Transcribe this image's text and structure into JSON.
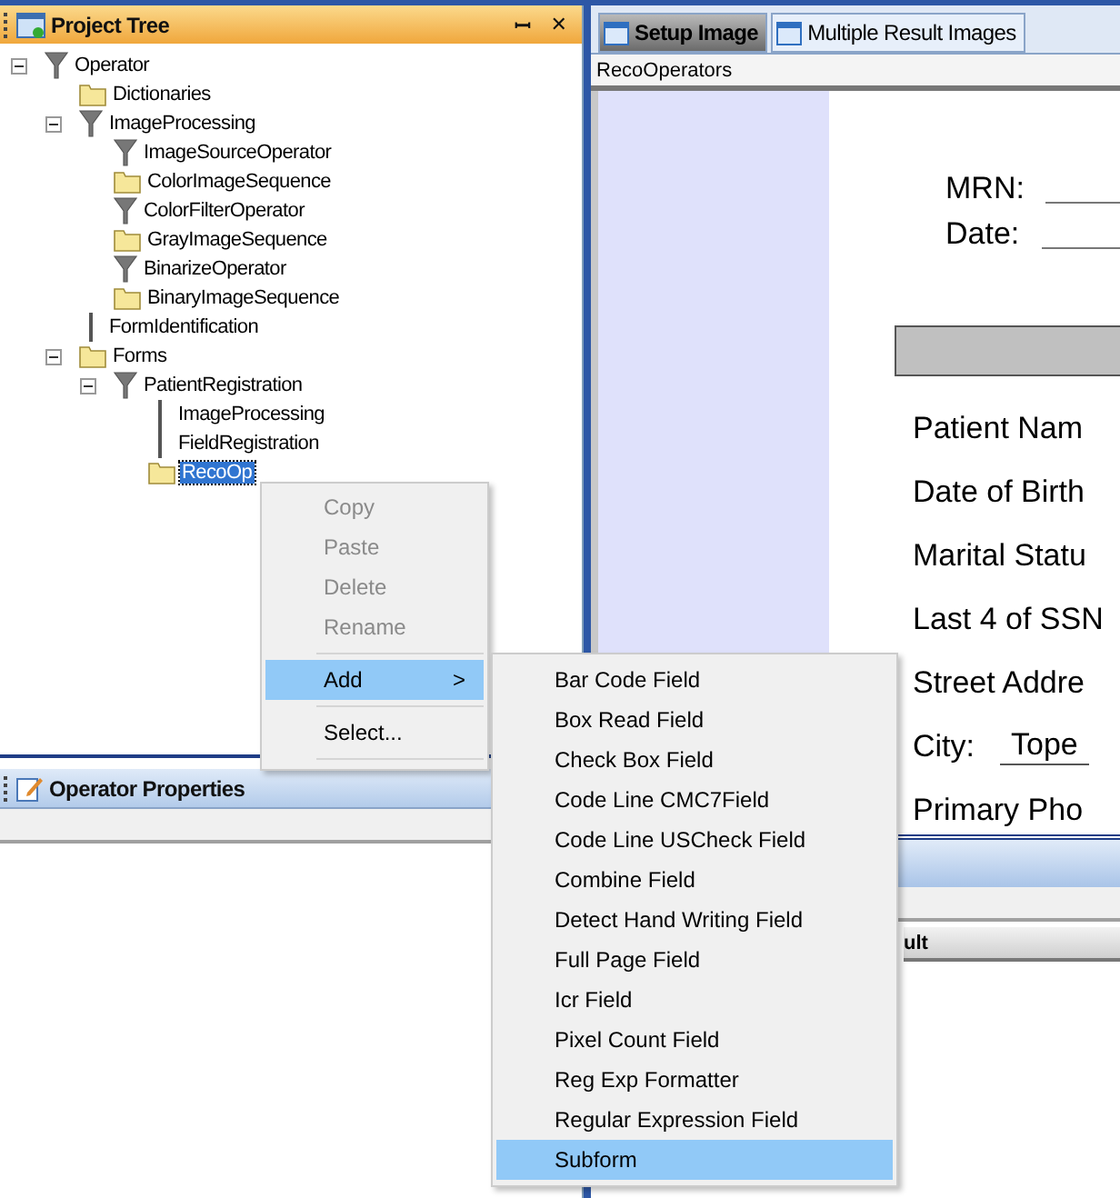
{
  "project_tree": {
    "title": "Project Tree",
    "pin": "ꟷ",
    "close": "✕",
    "nodes": [
      {
        "label": "Operator",
        "kind": "operator",
        "expanded": true,
        "selected": false,
        "children": [
          {
            "label": "Dictionaries",
            "kind": "folder",
            "selected": false
          },
          {
            "label": "ImageProcessing",
            "kind": "operator",
            "expanded": true,
            "selected": false,
            "children": [
              {
                "label": "ImageSourceOperator",
                "kind": "operator",
                "selected": false
              },
              {
                "label": "ColorImageSequence",
                "kind": "folder",
                "selected": false
              },
              {
                "label": "ColorFilterOperator",
                "kind": "operator",
                "selected": false
              },
              {
                "label": "GrayImageSequence",
                "kind": "folder",
                "selected": false
              },
              {
                "label": "BinarizeOperator",
                "kind": "operator",
                "selected": false
              },
              {
                "label": "BinaryImageSequence",
                "kind": "folder",
                "selected": false
              }
            ]
          },
          {
            "label": "FormIdentification",
            "kind": "item",
            "selected": false
          },
          {
            "label": "Forms",
            "kind": "folder",
            "expanded": true,
            "selected": false,
            "children": [
              {
                "label": "PatientRegistration",
                "kind": "operator",
                "expanded": true,
                "selected": false,
                "children": [
                  {
                    "label": "ImageProcessing",
                    "kind": "item",
                    "selected": false
                  },
                  {
                    "label": "FieldRegistration",
                    "kind": "item",
                    "selected": false
                  },
                  {
                    "label": "RecoOp",
                    "kind": "folder",
                    "selected": true
                  }
                ]
              }
            ]
          }
        ]
      }
    ]
  },
  "operator_properties": {
    "title": "Operator Properties"
  },
  "tabs": [
    {
      "label": "Setup Image",
      "selected": true
    },
    {
      "label": "Multiple Result Images",
      "selected": false
    }
  ],
  "breadcrumb": "RecoOperators",
  "form_image": {
    "header_fields": [
      "MRN:",
      "Date:"
    ],
    "rows": [
      {
        "label": "Patient Nam"
      },
      {
        "label": "Date of Birth"
      },
      {
        "label": "Marital Statu"
      },
      {
        "label": "Last 4 of SSN"
      },
      {
        "label": "Street Addre"
      },
      {
        "label": "City:",
        "value": "Tope"
      },
      {
        "label": "Primary Pho"
      }
    ]
  },
  "result_panel": {
    "column_1": "ult"
  },
  "context_menu": {
    "items": [
      {
        "label": "Copy",
        "disabled": true,
        "selected": false
      },
      {
        "label": "Paste",
        "disabled": true,
        "selected": false
      },
      {
        "label": "Delete",
        "disabled": true,
        "selected": false
      },
      {
        "label": "Rename",
        "disabled": true,
        "selected": false
      },
      {
        "label": "Add",
        "disabled": false,
        "selected": true,
        "submenu": true
      },
      {
        "label": "Select...",
        "disabled": false,
        "selected": false
      }
    ],
    "submenu_arrow": ">"
  },
  "submenu": {
    "items": [
      {
        "label": "Bar Code Field",
        "selected": false
      },
      {
        "label": "Box Read Field",
        "selected": false
      },
      {
        "label": "Check Box Field",
        "selected": false
      },
      {
        "label": "Code Line CMC7Field",
        "selected": false
      },
      {
        "label": "Code Line USCheck Field",
        "selected": false
      },
      {
        "label": "Combine Field",
        "selected": false
      },
      {
        "label": "Detect Hand Writing Field",
        "selected": false
      },
      {
        "label": "Full Page Field",
        "selected": false
      },
      {
        "label": "Icr Field",
        "selected": false
      },
      {
        "label": "Pixel Count Field",
        "selected": false
      },
      {
        "label": "Reg Exp Formatter",
        "selected": false
      },
      {
        "label": "Regular Expression Field",
        "selected": false
      },
      {
        "label": "Subform",
        "selected": true
      }
    ]
  }
}
